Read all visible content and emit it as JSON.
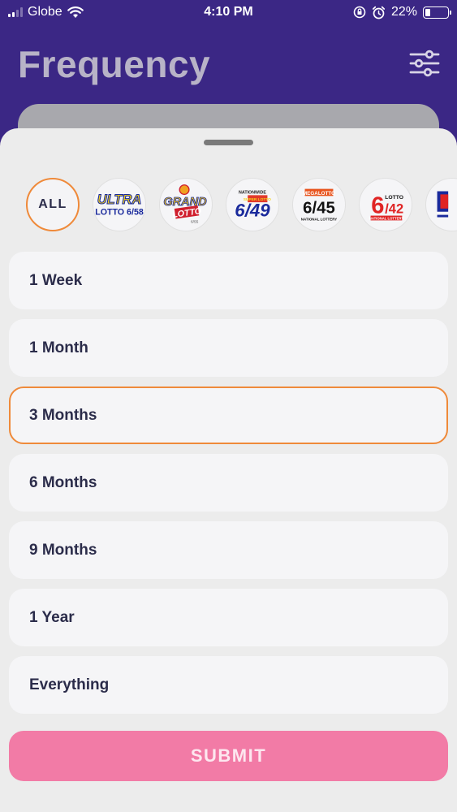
{
  "status": {
    "carrier": "Globe",
    "time": "4:10 PM",
    "battery": "22%",
    "battery_level": 0.22
  },
  "header": {
    "title": "Frequency"
  },
  "games": [
    {
      "id": "all",
      "label": "ALL",
      "selected": true
    },
    {
      "id": "ultra-lotto-6-58",
      "logo_lines": [
        "ULTRA",
        "LOTTO 6/58"
      ]
    },
    {
      "id": "grand-lotto-6-55",
      "logo_lines": [
        "GRAND",
        "LOTTO",
        "6/55"
      ]
    },
    {
      "id": "super-lotto-6-49",
      "logo_lines": [
        "NATIONWIDE",
        "SUPER LOTTO",
        "6/49"
      ]
    },
    {
      "id": "mega-lotto-6-45",
      "logo_lines": [
        "MEGALOTTO",
        "6/45",
        "NATIONAL LOTTERY"
      ]
    },
    {
      "id": "lotto-6-42",
      "logo_lines": [
        "6",
        "LOTTO",
        "/42",
        "NATIONAL LOTTERY"
      ]
    },
    {
      "id": "more-game",
      "logo_lines": []
    }
  ],
  "periods": [
    {
      "label": "1 Week",
      "selected": false
    },
    {
      "label": "1 Month",
      "selected": false
    },
    {
      "label": "3 Months",
      "selected": true
    },
    {
      "label": "6 Months",
      "selected": false
    },
    {
      "label": "9 Months",
      "selected": false
    },
    {
      "label": "1 Year",
      "selected": false
    },
    {
      "label": "Everything",
      "selected": false
    }
  ],
  "actions": {
    "submit_label": "SUBMIT"
  },
  "colors": {
    "header_bg": "#3b2785",
    "sheet_bg": "#ececec",
    "option_bg": "#f5f5f7",
    "accent_orange": "#ef8a3a",
    "submit_pink": "#f27ba6",
    "text_dark": "#2b2c4a"
  }
}
